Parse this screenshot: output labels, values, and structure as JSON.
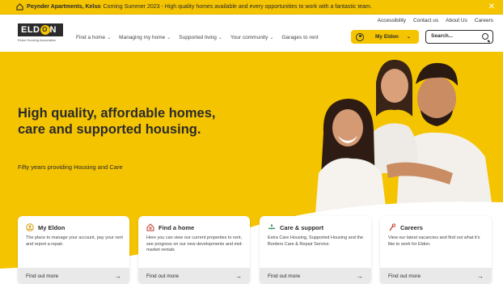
{
  "announcement": {
    "bold": "Poynder Apartments, Kelso",
    "text": "Coming Summer 2023 - High quality homes available and every opportunities to work with a fantastic team."
  },
  "utility_links": [
    "Accessibility",
    "Contact us",
    "About Us",
    "Careers"
  ],
  "logo": {
    "word_a": "ELD",
    "word_o": "O",
    "word_b": "N",
    "tagline": "Eldon Housing Association"
  },
  "nav": [
    {
      "label": "Find a home"
    },
    {
      "label": "Managing my home"
    },
    {
      "label": "Supported living"
    },
    {
      "label": "Your community"
    },
    {
      "label": "Garages to rent"
    }
  ],
  "my_eldon_button": "My Eldon",
  "search": {
    "placeholder": "Search..."
  },
  "hero": {
    "title": "High quality, affordable homes, care and supported housing.",
    "subtitle": "Fifty years providing Housing and Care"
  },
  "cards": [
    {
      "title": "My Eldon",
      "icon": "user-circle-icon",
      "desc": "The place to manage your account, pay your rent and report a repair.",
      "cta": "Find out more"
    },
    {
      "title": "Find a home",
      "icon": "house-search-icon",
      "desc": "Here you can view our current properties to rent, see progress on our new developments and mid-market rentals",
      "cta": "Find out more"
    },
    {
      "title": "Care & support",
      "icon": "care-hands-icon",
      "desc": "Extra Care Housing, Supported Housing and the Borders Care & Repair Service.",
      "cta": "Find out more"
    },
    {
      "title": "Careers",
      "icon": "careers-icon",
      "desc": "View our latest vacancies and find out what it's like to work for Eldon.",
      "cta": "Find out more"
    }
  ],
  "colors": {
    "brand_yellow": "#f5c400",
    "dark": "#2b2b2b",
    "card_footer": "#e9e9e9"
  }
}
